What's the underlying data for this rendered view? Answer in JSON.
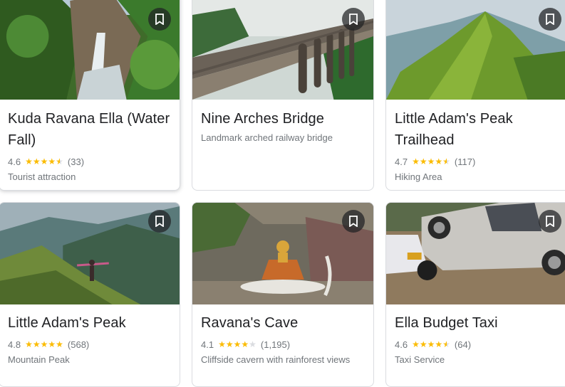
{
  "cards": [
    {
      "title": "Kuda Ravana Ella (Water Fall)",
      "rating": "4.6",
      "stars": 4.6,
      "reviews": "(33)",
      "category": "Tourist attraction"
    },
    {
      "title": "Nine Arches Bridge",
      "description": "Landmark arched railway bridge"
    },
    {
      "title": "Little Adam's Peak Trailhead",
      "rating": "4.7",
      "stars": 4.7,
      "reviews": "(117)",
      "category": "Hiking Area"
    },
    {
      "title": "Little Adam's Peak",
      "rating": "4.8",
      "stars": 4.8,
      "reviews": "(568)",
      "category": "Mountain Peak"
    },
    {
      "title": "Ravana's Cave",
      "rating": "4.1",
      "stars": 4.1,
      "reviews": "(1,195)",
      "category": "Cliffside cavern with rainforest views"
    },
    {
      "title": "Ella Budget Taxi",
      "rating": "4.6",
      "stars": 4.6,
      "reviews": "(64)",
      "category": "Taxi Service"
    }
  ],
  "colors": {
    "star": "#fbbc04",
    "star_empty": "#dadce0",
    "secondary_text": "#70757a"
  },
  "icons": {
    "save": "bookmark-icon",
    "star": "star-icon"
  }
}
